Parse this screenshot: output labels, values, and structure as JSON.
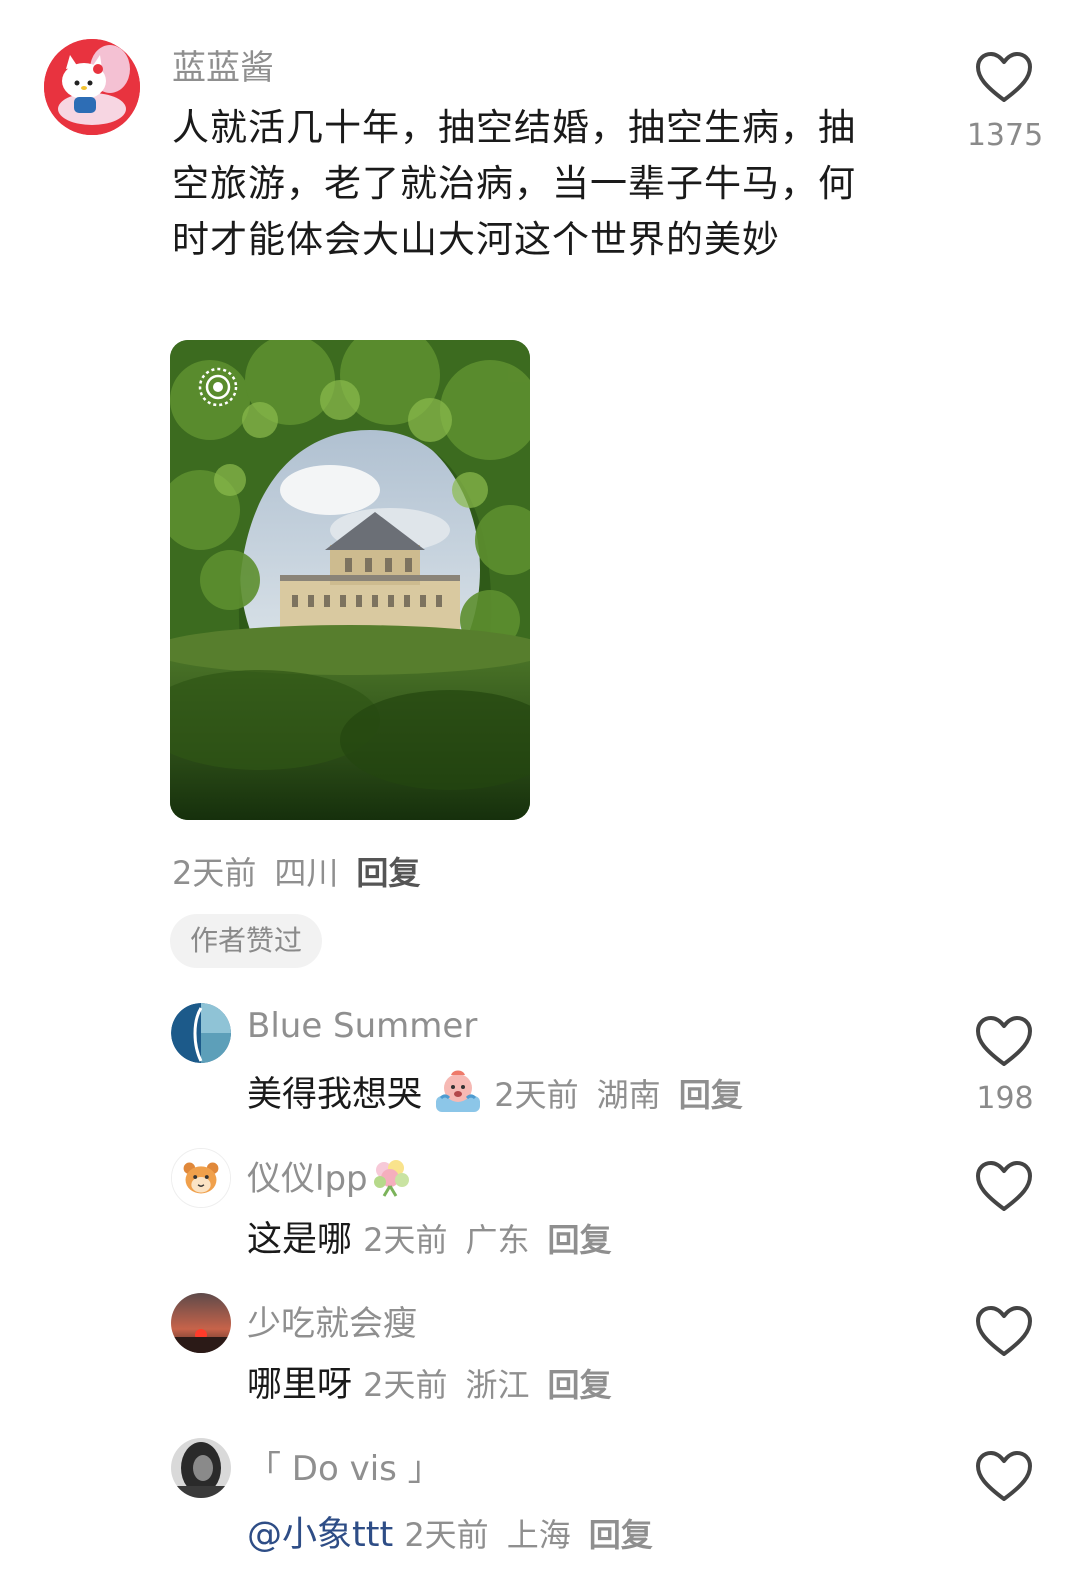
{
  "main_comment": {
    "username": "蓝蓝酱",
    "text": "人就活几十年，抽空结婚，抽空生病，抽空旅游，老了就治病，当一辈子牛马，何时才能体会大山大河这个世界的美妙",
    "time": "2天前",
    "location": "四川",
    "reply_label": "回复",
    "badge": "作者赞过",
    "likes": "1375"
  },
  "replies": [
    {
      "username": "Blue Summer",
      "text": "美得我想哭",
      "emoji": "crying-face-sticker",
      "time": "2天前",
      "location": "湖南",
      "reply_label": "回复",
      "likes": "198"
    },
    {
      "username": "仪仪lpp",
      "name_emoji": "bouquet-icon",
      "text": "这是哪",
      "time": "2天前",
      "location": "广东",
      "reply_label": "回复",
      "likes": ""
    },
    {
      "username": "少吃就会瘦",
      "text": "哪里呀",
      "time": "2天前",
      "location": "浙江",
      "reply_label": "回复",
      "likes": ""
    },
    {
      "username": "「 Do vis 」",
      "mention": "@小象ttt",
      "text": "",
      "time": "2天前",
      "location": "上海",
      "reply_label": "回复",
      "likes": ""
    }
  ],
  "colors": {
    "text_primary": "#1a1a1a",
    "text_secondary": "#8f8f8f",
    "mention": "#2e4d86",
    "badge_bg": "#f2f2f2"
  }
}
